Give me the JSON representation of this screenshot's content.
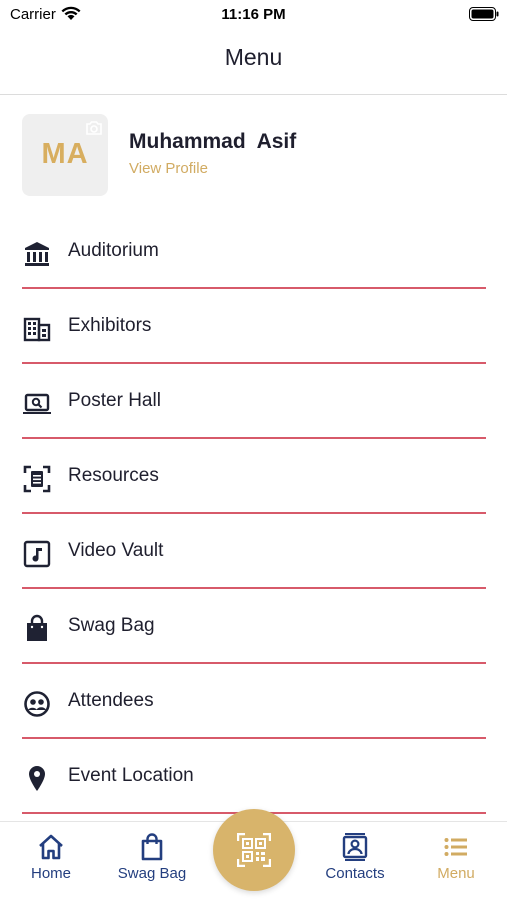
{
  "status_bar": {
    "carrier": "Carrier",
    "time": "11:16 PM"
  },
  "header": {
    "title": "Menu"
  },
  "profile": {
    "initials": "MA",
    "name": "Muhammad  Asif",
    "link": "View Profile"
  },
  "menu": {
    "items": [
      {
        "label": "Auditorium",
        "icon": "auditorium-icon"
      },
      {
        "label": "Exhibitors",
        "icon": "building-icon"
      },
      {
        "label": "Poster Hall",
        "icon": "laptop-search-icon"
      },
      {
        "label": "Resources",
        "icon": "document-scan-icon"
      },
      {
        "label": "Video Vault",
        "icon": "music-note-icon"
      },
      {
        "label": "Swag Bag",
        "icon": "shopping-bag-icon"
      },
      {
        "label": "Attendees",
        "icon": "attendees-icon"
      },
      {
        "label": "Event Location",
        "icon": "location-pin-icon"
      }
    ]
  },
  "tabbar": {
    "home": "Home",
    "swag_bag": "Swag Bag",
    "contacts": "Contacts",
    "menu": "Menu"
  },
  "colors": {
    "accent_gold": "#d1ab62",
    "divider_red": "#d75a6a",
    "tab_blue": "#233e7f"
  }
}
